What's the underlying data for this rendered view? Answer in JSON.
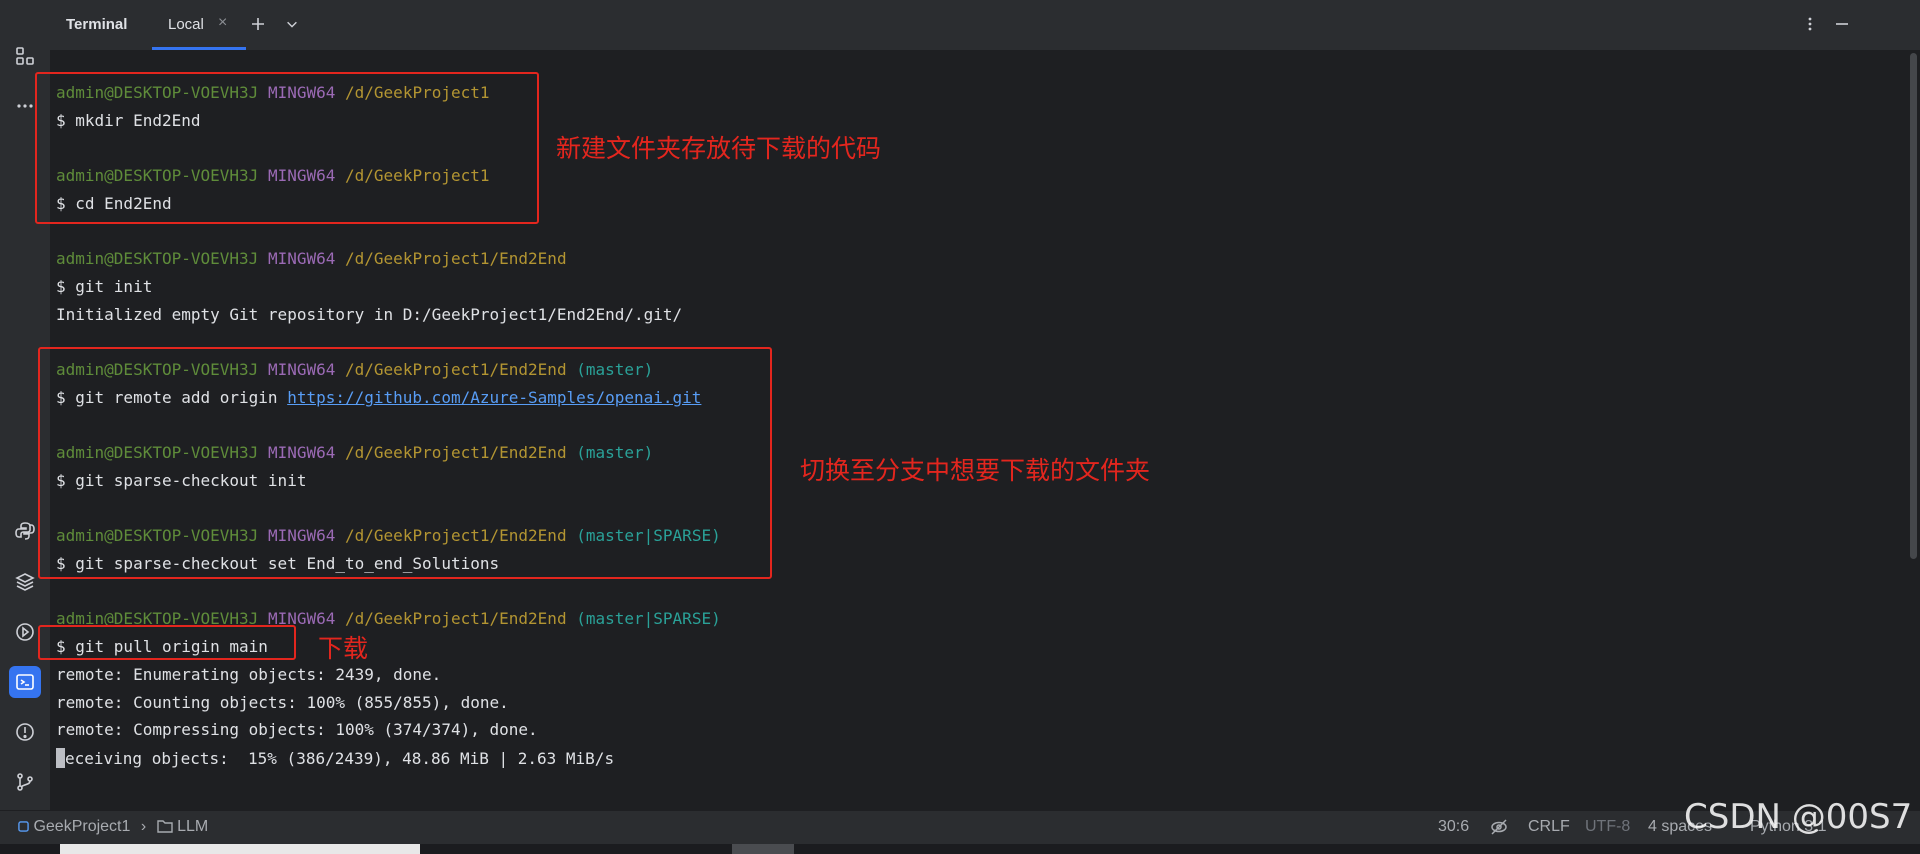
{
  "header": {
    "panel_title": "Terminal",
    "tab_label": "Local",
    "tab_close": "×"
  },
  "terminal": {
    "user": "admin@DESKTOP-VOEVH3J",
    "sys": "MINGW64",
    "lines": {
      "l1_path": "/d/GeekProject1",
      "l2_cmd": "$ mkdir End2End",
      "l3_path": "/d/GeekProject1",
      "l4_cmd": "$ cd End2End",
      "l5_path": "/d/GeekProject1/End2End",
      "l6_cmd": "$ git init",
      "l7_out": "Initialized empty Git repository in D:/GeekProject1/End2End/.git/",
      "l8_path": "/d/GeekProject1/End2End",
      "l8_branch": "(master)",
      "l9_cmd": "$ git remote add origin ",
      "l9_url": "https://github.com/Azure-Samples/openai.git",
      "l10_path": "/d/GeekProject1/End2End",
      "l10_branch": "(master)",
      "l11_cmd": "$ git sparse-checkout init",
      "l12_path": "/d/GeekProject1/End2End",
      "l12_branch": "(master|SPARSE)",
      "l13_cmd": "$ git sparse-checkout set End_to_end_Solutions",
      "l14_path": "/d/GeekProject1/End2End",
      "l14_branch": "(master|SPARSE)",
      "l15_cmd": "$ git pull origin main",
      "l16_out": "remote: Enumerating objects: 2439, done.",
      "l17_out": "remote: Counting objects: 100% (855/855), done.",
      "l18_out": "remote: Compressing objects: 100% (374/374), done.",
      "l19_out": "eceiving objects:  15% (386/2439), 48.86 MiB | 2.63 MiB/s"
    }
  },
  "annotations": {
    "note1": "新建文件夹存放待下载的代码",
    "note2": "切换至分支中想要下载的文件夹",
    "note3": "下载"
  },
  "statusbar": {
    "project": "GeekProject1",
    "folder": "LLM",
    "position": "30:6",
    "line_ending": "CRLF",
    "encoding": "UTF-8",
    "indent": "4 spaces",
    "interpreter": "Python 3.1"
  },
  "watermark": "CSDN @00S7",
  "colors": {
    "accent": "#3574f0",
    "annotation_red": "#e3261e",
    "user": "#5f8c3a",
    "mingw": "#9b6ab5",
    "path": "#b39532",
    "branch": "#2aa198"
  },
  "icons": [
    "structure-icon",
    "more-icon",
    "python-console-icon",
    "layers-icon",
    "services-icon",
    "terminal-icon",
    "problems-icon",
    "git-icon",
    "plus-icon",
    "chevron-down-icon",
    "kebab-icon",
    "minimize-icon",
    "module-icon",
    "folder-icon",
    "inspection-icon"
  ]
}
